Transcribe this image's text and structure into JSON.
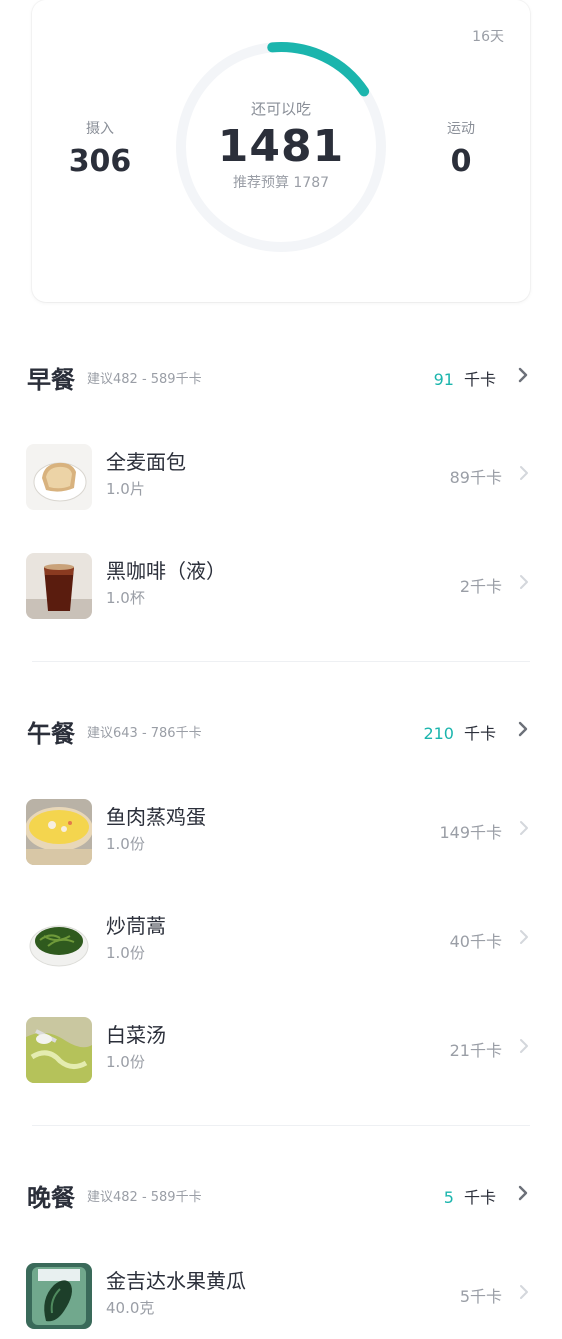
{
  "summary": {
    "days_label": "16天",
    "intake_label": "摄入",
    "intake_value": "306",
    "can_eat_label": "还可以吃",
    "remaining_value": "1481",
    "budget_text": "推荐预算 1787",
    "exercise_label": "运动",
    "exercise_value": "0",
    "ring_progress_fraction": 0.17,
    "ring_color": "#1bb5ad",
    "ring_track_color": "#f3f5f8"
  },
  "unit": "千卡",
  "meals": [
    {
      "title": "早餐",
      "suggest": "建议482 - 589千卡",
      "kcal": "91",
      "items": [
        {
          "name": "全麦面包",
          "qty": "1.0片",
          "kcal": "89千卡",
          "icon": "bread-icon"
        },
        {
          "name": "黑咖啡（液）",
          "qty": "1.0杯",
          "kcal": "2千卡",
          "icon": "coffee-icon"
        }
      ]
    },
    {
      "title": "午餐",
      "suggest": "建议643 - 786千卡",
      "kcal": "210",
      "items": [
        {
          "name": "鱼肉蒸鸡蛋",
          "qty": "1.0份",
          "kcal": "149千卡",
          "icon": "steamed-egg-icon"
        },
        {
          "name": "炒茼蒿",
          "qty": "1.0份",
          "kcal": "40千卡",
          "icon": "greens-icon"
        },
        {
          "name": "白菜汤",
          "qty": "1.0份",
          "kcal": "21千卡",
          "icon": "soup-icon"
        }
      ]
    },
    {
      "title": "晚餐",
      "suggest": "建议482 - 589千卡",
      "kcal": "5",
      "items": [
        {
          "name": "金吉达水果黄瓜",
          "qty": "40.0克",
          "kcal": "5千卡",
          "icon": "cucumber-icon"
        }
      ]
    }
  ],
  "colors": {
    "accent": "#1bb5ad",
    "text_dark": "#2b2f3a",
    "text_muted": "#9a9ea6"
  }
}
